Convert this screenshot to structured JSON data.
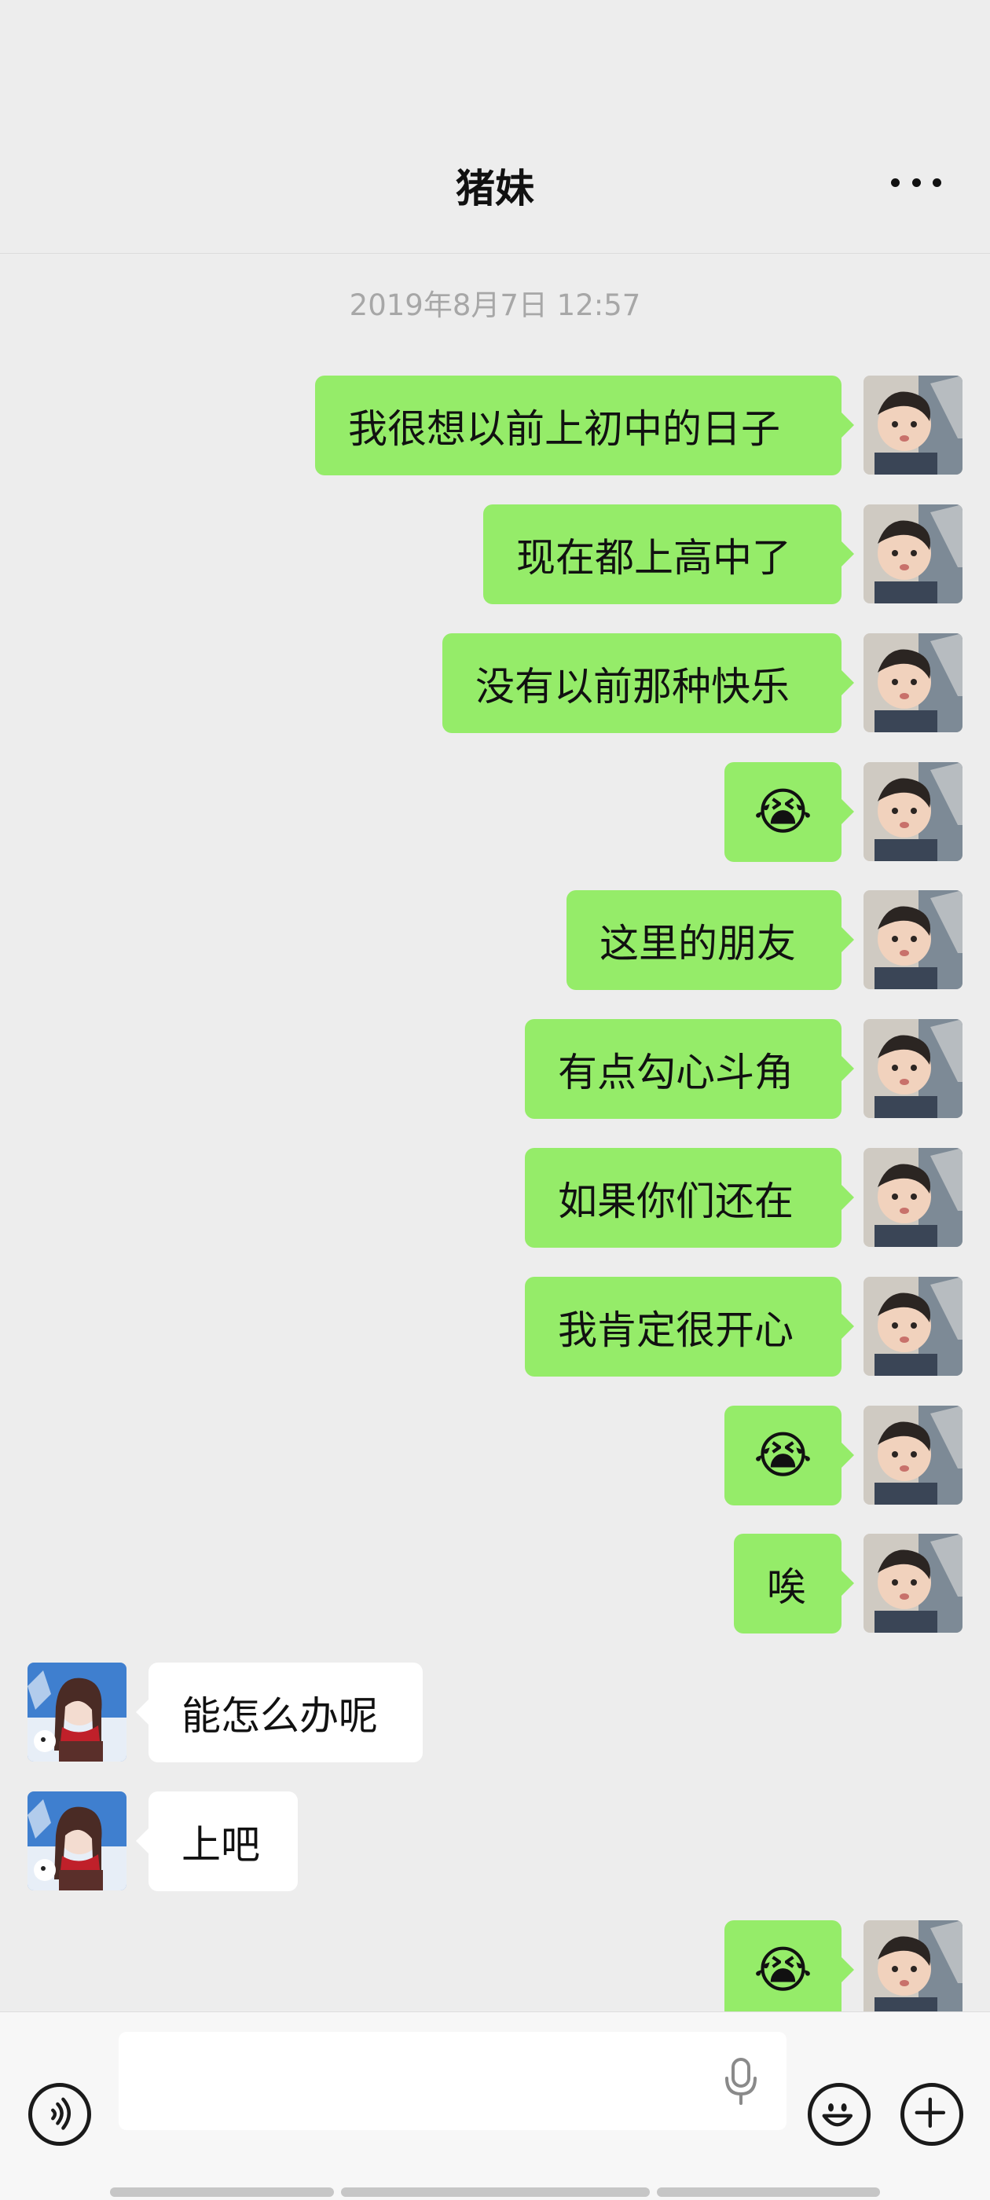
{
  "header": {
    "title": "猪妹",
    "more_icon": "more-dots-icon"
  },
  "timestamp": "2019年8月7日 12:57",
  "messages": [
    {
      "sender": "self",
      "text": "我很想以前上初中的日子"
    },
    {
      "sender": "self",
      "text": "现在都上高中了"
    },
    {
      "sender": "self",
      "text": "没有以前那种快乐"
    },
    {
      "sender": "self",
      "text": "😭"
    },
    {
      "sender": "self",
      "text": "这里的朋友"
    },
    {
      "sender": "self",
      "text": "有点勾心斗角"
    },
    {
      "sender": "self",
      "text": "如果你们还在"
    },
    {
      "sender": "self",
      "text": "我肯定很开心"
    },
    {
      "sender": "self",
      "text": "😭"
    },
    {
      "sender": "self",
      "text": "唉"
    },
    {
      "sender": "other",
      "text": "能怎么办呢"
    },
    {
      "sender": "other",
      "text": "上吧"
    },
    {
      "sender": "self",
      "text": "😭"
    }
  ],
  "input_bar": {
    "value": "",
    "voice_icon": "voice-icon",
    "mic_icon": "microphone-icon",
    "emoji_icon": "emoji-icon",
    "plus_icon": "plus-icon"
  },
  "colors": {
    "self_bubble": "#95ec69",
    "other_bubble": "#ffffff",
    "background": "#ededed"
  }
}
